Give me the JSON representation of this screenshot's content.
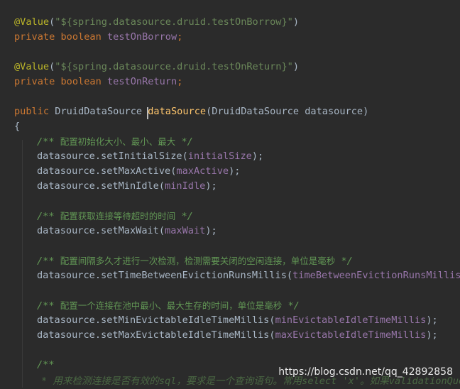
{
  "code": {
    "l1_ann": "@Value",
    "l1_paren": "(",
    "l1_str": "\"${spring.datasource.druid.testOnBorrow}\"",
    "l1_close": ")",
    "l2_private": "private",
    "l2_boolean": "boolean",
    "l2_field": "testOnBorrow",
    "l2_semi": ";",
    "l3_ann": "@Value",
    "l3_paren": "(",
    "l3_str": "\"${spring.datasource.druid.testOnReturn}\"",
    "l3_close": ")",
    "l4_private": "private",
    "l4_boolean": "boolean",
    "l4_field": "testOnReturn",
    "l4_semi": ";",
    "m_public": "public",
    "m_type": "DruidDataSource",
    "m_name": "dataSource",
    "m_params": "(DruidDataSource datasource)",
    "open_brace": "{",
    "c1_open": "/**",
    "c1_text": "配置初始化大小、最小、最大",
    "c1_close": "*/",
    "s1_call": "datasource.setInitialSize(",
    "s1_arg": "initialSize",
    "s1_end": ");",
    "s2_call": "datasource.setMaxActive(",
    "s2_arg": "maxActive",
    "s2_end": ");",
    "s3_call": "datasource.setMinIdle(",
    "s3_arg": "minIdle",
    "s3_end": ");",
    "c2_open": "/**",
    "c2_text": "配置获取连接等待超时的时间",
    "c2_close": "*/",
    "s4_call": "datasource.setMaxWait(",
    "s4_arg": "maxWait",
    "s4_end": ");",
    "c3_open": "/**",
    "c3_text": "配置间隔多久才进行一次检测，检测需要关闭的空闲连接，单位是毫秒",
    "c3_close": "*/",
    "s5_call": "datasource.setTimeBetweenEvictionRunsMillis(",
    "s5_arg": "timeBetweenEvictionRunsMillis",
    "s5_end": ");",
    "c4_open": "/**",
    "c4_text": "配置一个连接在池中最小、最大生存的时间，单位是毫秒",
    "c4_close": "*/",
    "s6_call": "datasource.setMinEvictableIdleTimeMillis(",
    "s6_arg": "minEvictableIdleTimeMillis",
    "s6_end": ");",
    "s7_call": "datasource.setMaxEvictableIdleTimeMillis(",
    "s7_arg": "maxEvictableIdleTimeMillis",
    "s7_end": ");",
    "c5_open": "/**",
    "c5_partial": "* 用来检测连接是否有效的sql，要求是一个查询语句。常用select 'x'。如果validationQuery"
  },
  "watermark": "https://blog.csdn.net/qq_42892858",
  "colors": {
    "background": "#2b2b2b",
    "keyword": "#cc7832",
    "annotation": "#bbb529",
    "string": "#6a8759",
    "field": "#9876aa",
    "doc_comment": "#629755",
    "plain": "#a9b7c6"
  }
}
